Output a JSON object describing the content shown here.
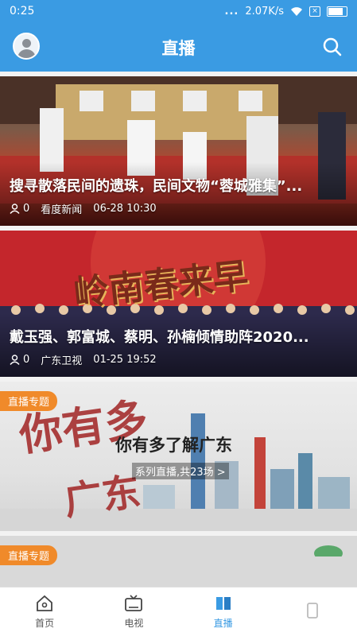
{
  "status": {
    "time": "0:25",
    "dots": "...",
    "speed": "2.07K/s"
  },
  "header": {
    "title": "直播"
  },
  "cards": [
    {
      "title": "搜寻散落民间的遗珠，民间文物“蓉城雅集”...",
      "viewers": "0",
      "source": "看度新闻",
      "date": "06-28 10:30"
    },
    {
      "title": "戴玉强、郭富城、蔡明、孙楠倾情助阵2020...",
      "banner": "岭南春来早",
      "viewers": "0",
      "source": "广东卫视",
      "date": "01-25 19:52"
    },
    {
      "tag": "直播专题",
      "calli_top": "你有多",
      "calli_bottom": "广东",
      "headline": "你有多了解广东",
      "sub": "系列直播,共23场 >"
    },
    {
      "tag": "直播专题"
    }
  ],
  "tabs": [
    {
      "label": "首页"
    },
    {
      "label": "电视"
    },
    {
      "label": "直播"
    },
    {
      "label": ""
    }
  ],
  "colors": {
    "primary": "#3a9be3",
    "tag": "#f08a2a"
  }
}
